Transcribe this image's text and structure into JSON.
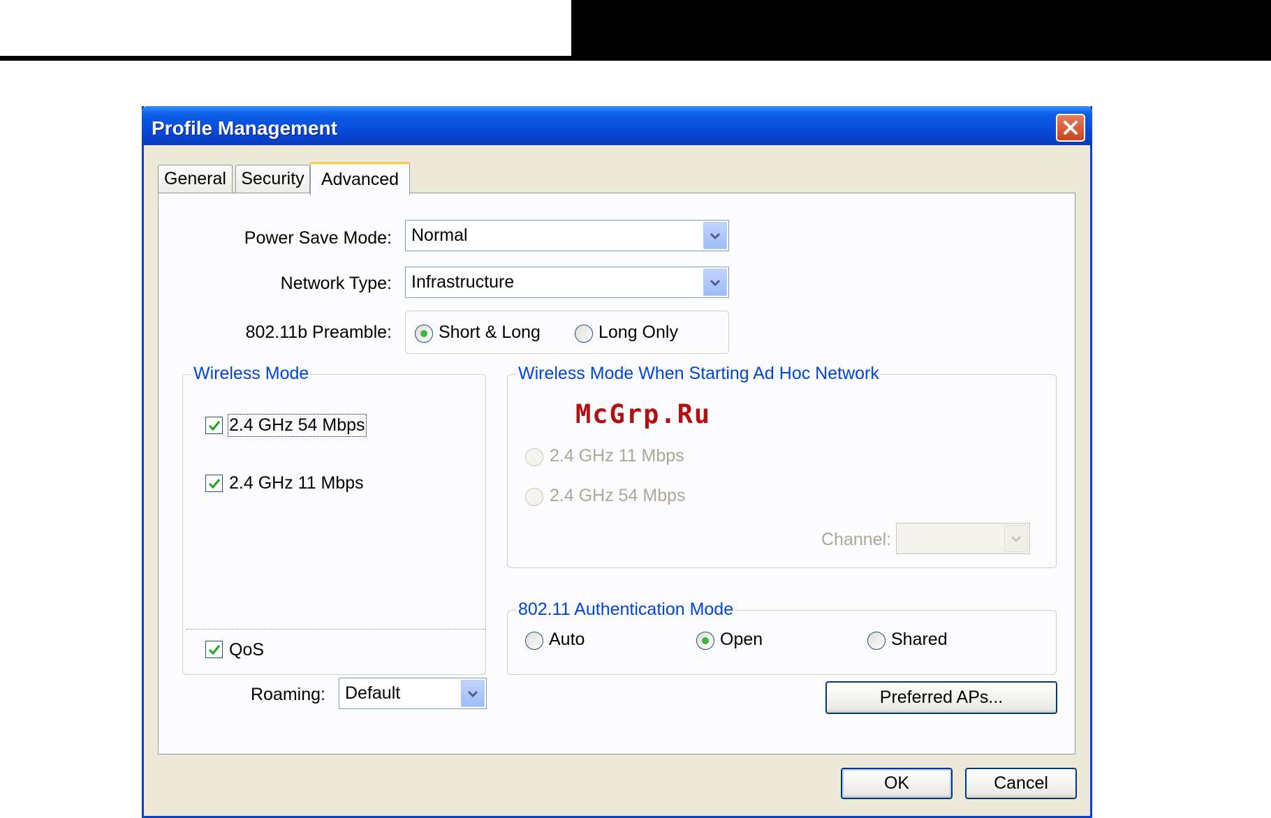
{
  "window": {
    "title": "Profile Management"
  },
  "tabs": [
    {
      "label": "General",
      "active": false
    },
    {
      "label": "Security",
      "active": false
    },
    {
      "label": "Advanced",
      "active": true
    }
  ],
  "advanced": {
    "power_save_mode": {
      "label": "Power Save Mode:",
      "value": "Normal"
    },
    "network_type": {
      "label": "Network Type:",
      "value": "Infrastructure"
    },
    "preamble": {
      "label": "802.11b Preamble:",
      "options": [
        {
          "label": "Short & Long",
          "checked": true
        },
        {
          "label": "Long Only",
          "checked": false
        }
      ]
    },
    "wireless_mode": {
      "legend": "Wireless Mode",
      "options": [
        {
          "label": "2.4 GHz 54 Mbps",
          "checked": true
        },
        {
          "label": "2.4 GHz 11 Mbps",
          "checked": true
        }
      ],
      "qos": {
        "label": "QoS",
        "checked": true
      }
    },
    "adhoc_mode": {
      "legend": "Wireless Mode When Starting Ad Hoc Network",
      "options": [
        {
          "label": "2.4 GHz 11 Mbps",
          "checked": false,
          "disabled": true
        },
        {
          "label": "2.4 GHz 54 Mbps",
          "checked": false,
          "disabled": true
        }
      ],
      "channel": {
        "label": "Channel:",
        "value": ""
      }
    },
    "auth_mode": {
      "legend": "802.11 Authentication Mode",
      "options": [
        {
          "label": "Auto",
          "checked": false
        },
        {
          "label": "Open",
          "checked": true
        },
        {
          "label": "Shared",
          "checked": false
        }
      ]
    },
    "roaming": {
      "label": "Roaming:",
      "value": "Default"
    },
    "preferred_aps_label": "Preferred APs..."
  },
  "footer": {
    "ok_label": "OK",
    "cancel_label": "Cancel"
  },
  "watermark": "McGrp.Ru",
  "colors": {
    "title_bar": "#0846d8",
    "legend_text": "#0046d5",
    "dialog_bg": "#ece9d8",
    "tab_highlight": "#ffc83c"
  }
}
